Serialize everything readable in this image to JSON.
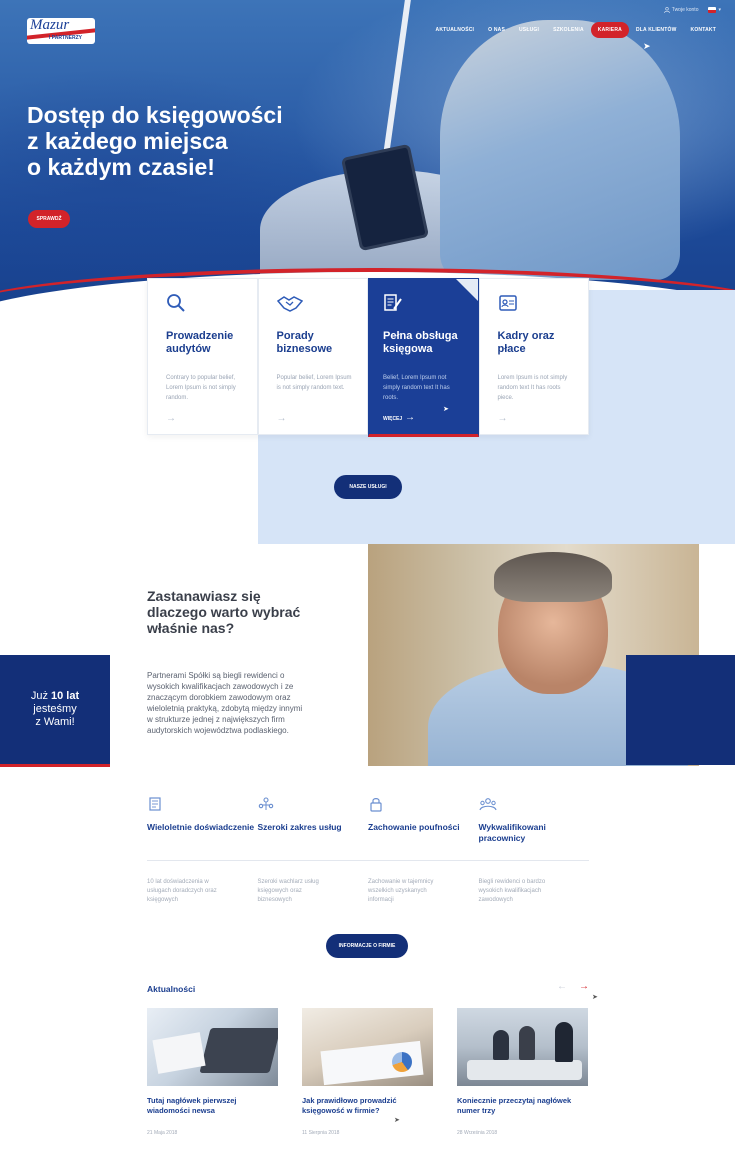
{
  "header": {
    "logo": {
      "name": "Mazur",
      "sub": "I PARTNERZY"
    },
    "account_label": "Twoje konto",
    "nav": [
      "AKTUALNOŚCI",
      "O NAS",
      "USŁUGI",
      "SZKOLENIA",
      "KARIERA",
      "DLA KLIENTÓW",
      "KONTAKT"
    ],
    "active_nav": "KARIERA"
  },
  "hero": {
    "lines": [
      "Dostęp do księgowości",
      "z każdego miejsca",
      "o każdym czasie!"
    ],
    "cta": "SPRAWDŹ"
  },
  "services": {
    "cards": [
      {
        "title": "Prowadzenie audytów",
        "text": "Contrary to popular belief, Lorem Ipsum is not simply random.",
        "icon": "magnifier-icon"
      },
      {
        "title": "Porady biznesowe",
        "text": "Popular belief, Lorem Ipsum is not simply random text.",
        "icon": "handshake-icon"
      },
      {
        "title": "Pełna obsługa księgowa",
        "text": "Belief, Lorem Ipsum not simply random text It has roots.",
        "icon": "document-pen-icon",
        "more": "WIĘCEJ"
      },
      {
        "title": "Kadry oraz płace",
        "text": "Lorem Ipsum is not simply random text It has roots piece.",
        "icon": "id-card-icon"
      }
    ],
    "button": "NASZE USŁUGI"
  },
  "why": {
    "title": [
      "Zastanawiasz się",
      "dlaczego warto wybrać",
      "właśnie nas?"
    ],
    "body": "Partnerami Spółki są biegli rewidenci o wysokich kwalifikacjach zawodowych i ze znaczącym dorobkiem zawodowym oraz wieloletnią praktyką, zdobytą między innymi w strukturze jednej z największych firm audytorskich województwa podlaskiego.",
    "years": {
      "pre": "Już",
      "number": "10 lat",
      "line2": "jesteśmy",
      "line3": "z Wami!"
    }
  },
  "features": {
    "items": [
      {
        "title": "Wieloletnie doświadczenie",
        "text": "10 lat doświadczenia w usługach doradczych oraz księgowych",
        "icon": "scroll-icon"
      },
      {
        "title": "Szeroki zakres usług",
        "text": "Szeroki wachlarz usług księgowych oraz biznesowych",
        "icon": "people-network-icon"
      },
      {
        "title": "Zachowanie poufności",
        "text": "Zachowanie w tajemnicy wszelkich uzyskanych informacji",
        "icon": "padlock-icon"
      },
      {
        "title": "Wykwalifikowani pracownicy",
        "text": "Biegli rewidenci o bardzo wysokich kwalifikacjach zawodowych",
        "icon": "team-icon"
      }
    ],
    "button": "INFORMACJE O FIRMIE"
  },
  "news": {
    "title": "Aktualności",
    "items": [
      {
        "title": "Tutaj nagłówek pierwszej wiadomości newsa",
        "date": "21 Maja 2018"
      },
      {
        "title": "Jak prawidłowo prowadzić księgowość w firmie?",
        "date": "11 Sierpnia 2018"
      },
      {
        "title": "Koniecznie przeczytaj nagłówek numer trzy",
        "date": "28 Września 2018"
      }
    ]
  }
}
